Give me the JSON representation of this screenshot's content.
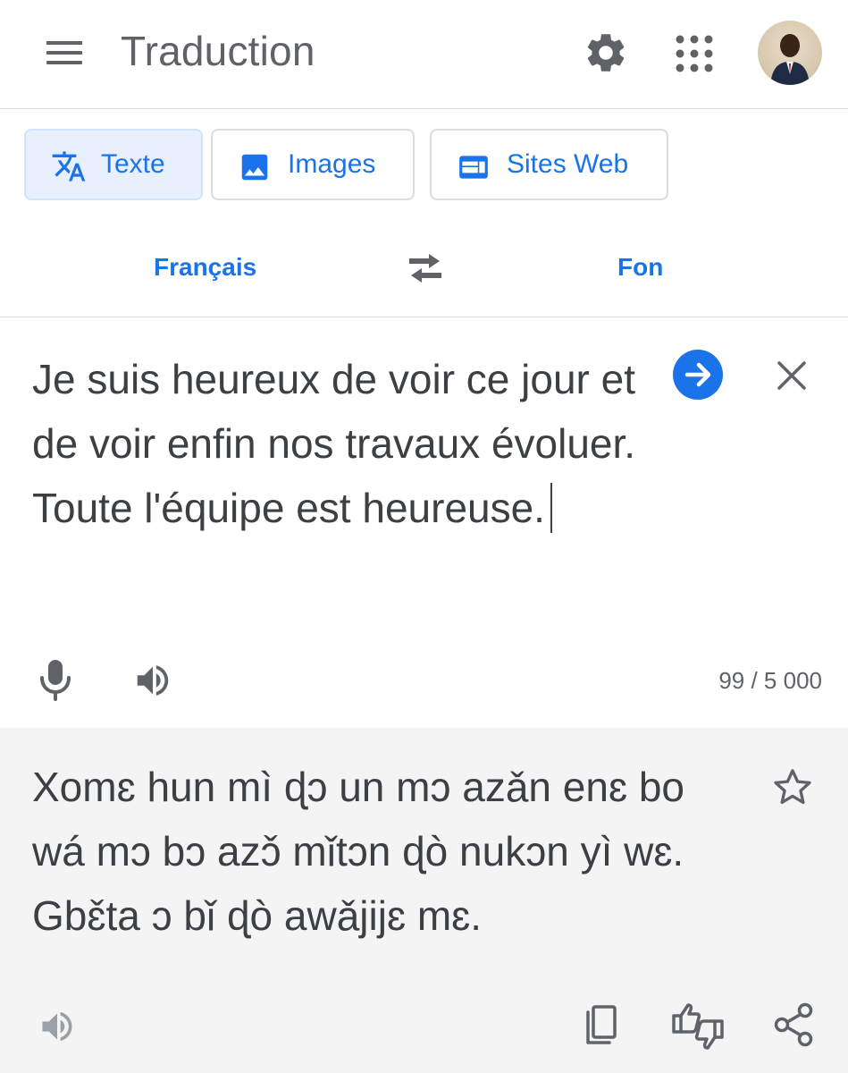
{
  "header": {
    "title": "Traduction",
    "menu_icon": "hamburger-menu-icon",
    "settings_icon": "gear-icon",
    "apps_icon": "apps-grid-icon",
    "avatar_icon": "user-avatar"
  },
  "tabs": [
    {
      "label": "Texte",
      "icon": "translate-icon",
      "active": true
    },
    {
      "label": "Images",
      "icon": "image-icon",
      "active": false
    },
    {
      "label": "Sites Web",
      "icon": "website-icon",
      "active": false
    }
  ],
  "languages": {
    "source": "Français",
    "target": "Fon",
    "swap_icon": "swap-arrows-icon"
  },
  "source": {
    "text": "Je suis heureux de voir ce jour et de voir enfin nos travaux évoluer. Toute l'équipe est heureuse.",
    "char_count": "99 / 5 000"
  },
  "result": {
    "text": "Xomɛ hun mì ɖɔ un mɔ azǎn enɛ bo wá mɔ bɔ azɔ̌ mǐtɔn ɖò nukɔn yì wɛ. Gbɛ̌ta ɔ bǐ ɖò awǎjijɛ mɛ."
  },
  "colors": {
    "accent": "#1a73e8",
    "active_tab_bg": "#e8f0fe",
    "result_bg": "#f4f4f4",
    "icon_gray": "#5f6368",
    "text": "#3c4043"
  }
}
